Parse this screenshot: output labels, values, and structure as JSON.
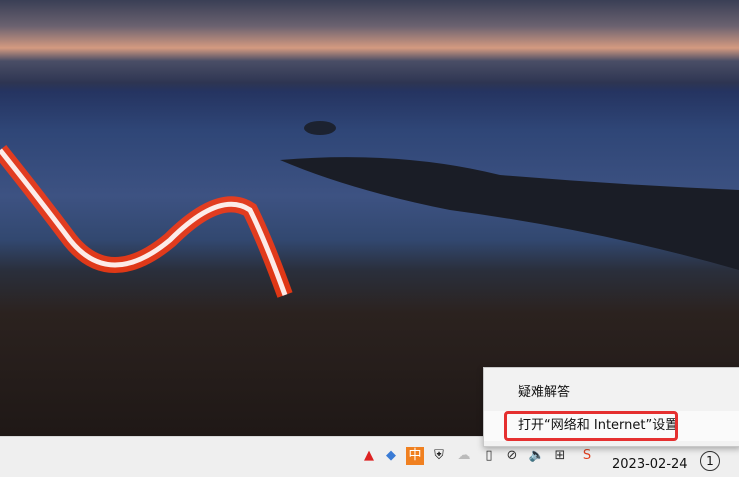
{
  "menu": {
    "items": [
      {
        "label": "疑难解答"
      },
      {
        "label": "打开“网络和 Internet”设置"
      }
    ]
  },
  "taskbar": {
    "date": "2023-02-24",
    "ime_label": "中",
    "notification_count": "1"
  },
  "colors": {
    "highlight": "#e53030",
    "ribbon": "#ff3a10"
  }
}
